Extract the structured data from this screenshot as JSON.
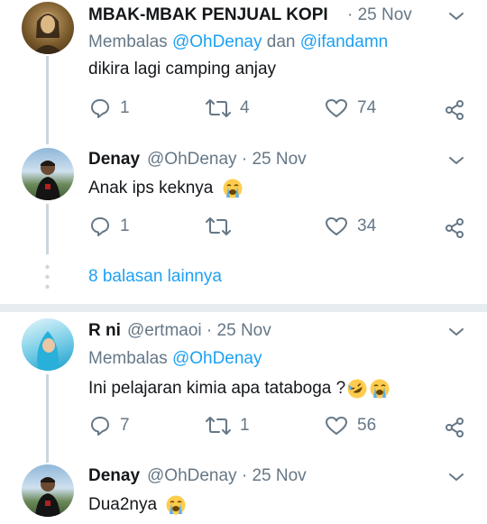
{
  "colors": {
    "accent": "#1da1f2",
    "muted": "#657786",
    "text": "#14171a",
    "line": "#ccd6dd"
  },
  "tweets": [
    {
      "name": "MBAK-MBAK PENJUAL KOPI",
      "meta": "· 25 Nov",
      "reply_prefix": "Membalas",
      "mention1": "@OhDenay",
      "reply_and": "dan",
      "mention2": "@ifandamn",
      "text": "dikira lagi camping anjay",
      "reply_count": "1",
      "retweet_count": "4",
      "like_count": "74"
    },
    {
      "name": "Denay",
      "meta": "@OhDenay · 25 Nov",
      "text": "Anak ips keknya",
      "emoji": "loudly-crying-face",
      "reply_count": "1",
      "retweet_count": "",
      "like_count": "34"
    },
    {
      "more_replies": "8 balasan lainnya"
    },
    {
      "name": "R ni",
      "meta": "@ertmaoi · 25 Nov",
      "reply_prefix": "Membalas",
      "mention1": "@OhDenay",
      "text": "Ini pelajaran kimia apa tataboga ?",
      "emoji": [
        "rolling-on-floor-laughing",
        "loudly-crying-face"
      ],
      "reply_count": "7",
      "retweet_count": "1",
      "like_count": "56"
    },
    {
      "name": "Denay",
      "meta": "@OhDenay · 25 Nov",
      "text": "Dua2nya",
      "emoji": "loudly-crying-face"
    }
  ]
}
